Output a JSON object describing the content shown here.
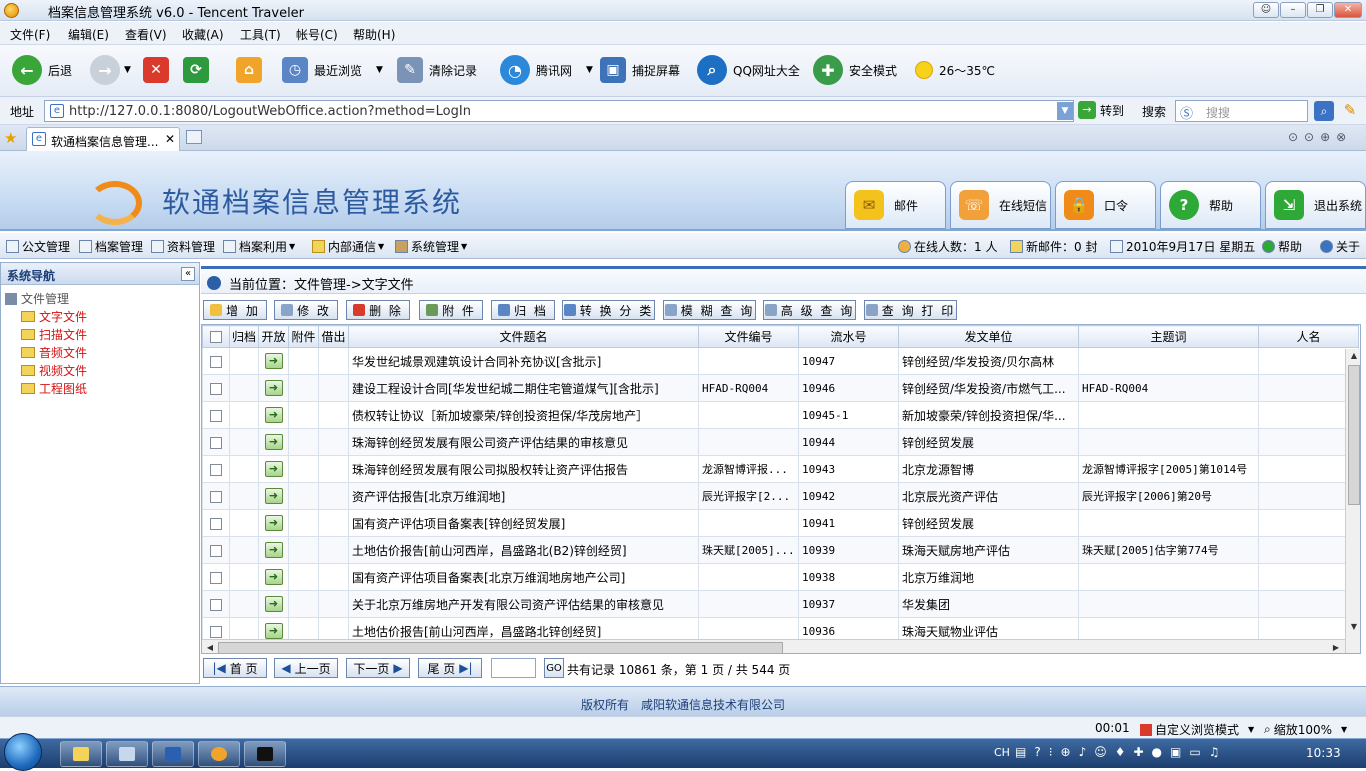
{
  "browser": {
    "title": "档案信息管理系统 v6.0 - Tencent Traveler",
    "menu": [
      "文件(F)",
      "编辑(E)",
      "查看(V)",
      "收藏(A)",
      "工具(T)",
      "帐号(C)",
      "帮助(H)"
    ],
    "toolbar": {
      "back": "后退",
      "recent": "最近浏览",
      "clear": "清除记录",
      "tencent": "腾讯网",
      "capture": "捕捉屏幕",
      "qqsites": "QQ网址大全",
      "safe": "安全模式",
      "weather": "26～35℃"
    },
    "address_label": "地址",
    "url": "http://127.0.0.1:8080/LogoutWebOffice.action?method=LogIn",
    "go": "转到",
    "search_label": "搜索",
    "search_placeholder": "搜搜",
    "tab": "软通档案信息管理..."
  },
  "app": {
    "name": "软通档案信息管理系统",
    "top_buttons": [
      "邮件",
      "在线短信",
      "口令",
      "帮助",
      "退出系统"
    ],
    "nav": {
      "items": [
        "公文管理",
        "档案管理",
        "资料管理",
        "档案利用",
        "内部通信",
        "系统管理"
      ],
      "online": "在线人数：1 人",
      "newmail": "新邮件：0 封",
      "date": "2010年9月17日 星期五",
      "help": "帮助",
      "about": "关于"
    },
    "sidebar": {
      "title": "系统导航",
      "root": "文件管理",
      "items": [
        "文字文件",
        "扫描文件",
        "音频文件",
        "视频文件",
        "工程图纸"
      ]
    },
    "location": "当前位置：文件管理->文字文件",
    "actions": [
      "增 加",
      "修 改",
      "删 除",
      "附 件",
      "归 档",
      "转 换 分 类",
      "模 糊 查 询",
      "高 级 查 询",
      "查 询 打 印"
    ],
    "columns": [
      "归档",
      "开放",
      "附件",
      "借出",
      "文件题名",
      "文件编号",
      "流水号",
      "发文单位",
      "主题词",
      "人名"
    ],
    "rows": [
      {
        "title": "华发世纪城景观建筑设计合同补充协议[含批示]",
        "code": "",
        "serial": "10947",
        "unit": "锌创经贸/华发投资/贝尔高林",
        "keywords": ""
      },
      {
        "title": "建设工程设计合同[华发世纪城二期住宅管道煤气][含批示]",
        "code": "HFAD-RQ004",
        "serial": "10946",
        "unit": "锌创经贸/华发投资/市燃气工...",
        "keywords": "HFAD-RQ004"
      },
      {
        "title": "债权转让协议［新加坡豪荣/锌创投资担保/华茂房地产］",
        "code": "",
        "serial": "10945-1",
        "unit": "新加坡豪荣/锌创投资担保/华...",
        "keywords": ""
      },
      {
        "title": "珠海锌创经贸发展有限公司资产评估结果的审核意见",
        "code": "",
        "serial": "10944",
        "unit": "锌创经贸发展",
        "keywords": ""
      },
      {
        "title": "珠海锌创经贸发展有限公司拟股权转让资产评估报告",
        "code": "龙源智博评报...",
        "serial": "10943",
        "unit": "北京龙源智博",
        "keywords": "龙源智博评报字[2005]第1014号"
      },
      {
        "title": "资产评估报告[北京万维润地]",
        "code": "辰光评报字[2...",
        "serial": "10942",
        "unit": "北京辰光资产评估",
        "keywords": "辰光评报字[2006]第20号"
      },
      {
        "title": "国有资产评估项目备案表[锌创经贸发展]",
        "code": "",
        "serial": "10941",
        "unit": "锌创经贸发展",
        "keywords": ""
      },
      {
        "title": "土地估价报告[前山河西岸，昌盛路北(B2)锌创经贸]",
        "code": "珠天赋[2005]...",
        "serial": "10939",
        "unit": "珠海天赋房地产评估",
        "keywords": "珠天赋[2005]估字第774号"
      },
      {
        "title": "国有资产评估项目备案表[北京万维润地房地产公司]",
        "code": "",
        "serial": "10938",
        "unit": "北京万维润地",
        "keywords": ""
      },
      {
        "title": "关于北京万维房地产开发有限公司资产评估结果的审核意见",
        "code": "",
        "serial": "10937",
        "unit": "华发集团",
        "keywords": ""
      },
      {
        "title": "土地估价报告[前山河西岸，昌盛路北锌创经贸]",
        "code": "",
        "serial": "10936",
        "unit": "珠海天赋物业评估",
        "keywords": ""
      }
    ],
    "pager": {
      "first": "首 页",
      "prev": "上一页",
      "next": "下一页",
      "last": "尾 页",
      "go": "GO",
      "summary": "共有记录 10861 条，第 1 页 / 共 544 页"
    },
    "footer": "版权所有　咸阳软通信息技术有限公司"
  },
  "status": {
    "time": "00:01",
    "mode": "自定义浏览模式",
    "zoom": "缩放100%"
  },
  "taskbar": {
    "lang": "CH",
    "clock": "10:33"
  }
}
